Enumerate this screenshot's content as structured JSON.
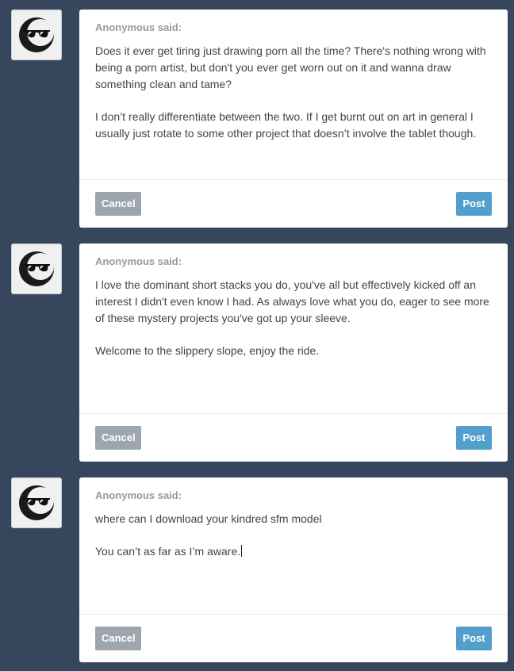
{
  "posts": [
    {
      "asker": "Anonymous said:",
      "question": "Does it ever get tiring just drawing porn all the time? There's nothing wrong with being a porn artist, but don't you ever get worn out on it and wanna draw something clean and tame?",
      "answer": "I don’t really differentiate between the two.  If I get burnt out on art in general I usually just rotate to some other project that doesn’t involve the tablet though.",
      "cancel_label": "Cancel",
      "post_label": "Post"
    },
    {
      "asker": "Anonymous said:",
      "question": "I love the dominant short stacks you do, you've all but effectively kicked off an interest I didn't even know I had. As always love what you do, eager to see more of these mystery projects you've got up your sleeve.",
      "answer": "Welcome to the slippery slope, enjoy the ride.",
      "cancel_label": "Cancel",
      "post_label": "Post"
    },
    {
      "asker": "Anonymous said:",
      "question": "where can I download your kindred sfm model",
      "answer": "You can’t as far as I’m aware.",
      "cancel_label": "Cancel",
      "post_label": "Post"
    }
  ],
  "colors": {
    "background": "#36465d",
    "card": "#ffffff",
    "cancel_button": "#9da6af",
    "post_button": "#529ecc",
    "asker_text": "#9a9a9a",
    "body_text": "#444444"
  },
  "icons": {
    "avatar": "anonymous-sunglasses-moon-icon"
  }
}
